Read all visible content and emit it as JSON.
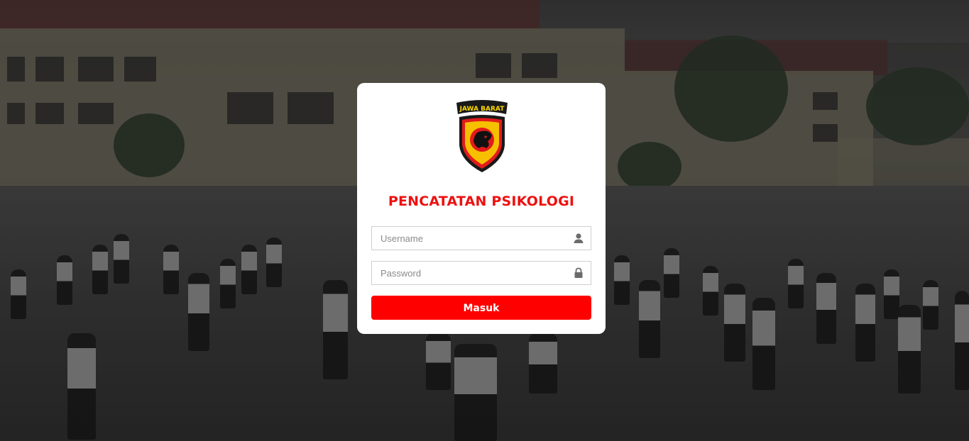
{
  "login": {
    "title": "PENCATATAN PSIKOLOGI",
    "logo_banner_text": "JAWA BARAT",
    "username": {
      "placeholder": "Username",
      "value": "",
      "icon": "user-icon"
    },
    "password": {
      "placeholder": "Password",
      "value": "",
      "icon": "lock-icon"
    },
    "submit_label": "Masuk"
  },
  "colors": {
    "accent": "#ff0000",
    "title": "#ee1010",
    "card_background": "#ffffff"
  }
}
